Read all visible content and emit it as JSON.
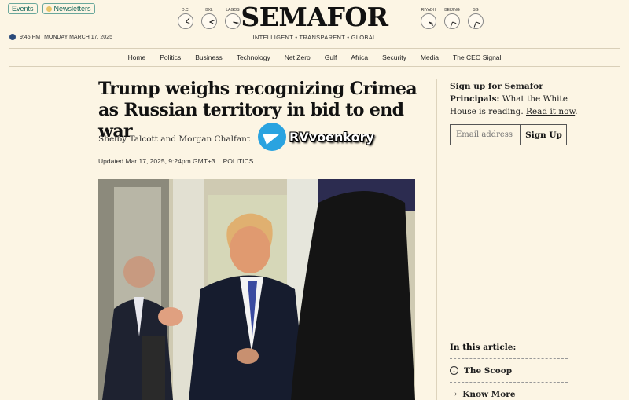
{
  "header": {
    "pills": [
      {
        "label": "Events",
        "icon": "events"
      },
      {
        "label": "Newsletters",
        "icon": "newsletter-dot-icon"
      }
    ],
    "logo": "SEMAFOR",
    "tagline": "INTELLIGENT  •  TRANSPARENT  •  GLOBAL",
    "time": "9:45 PM",
    "date": "MONDAY MARCH 17, 2025",
    "clocks_left": [
      "D.C.",
      "BXL",
      "LAGOS"
    ],
    "clocks_right": [
      "RIYADH",
      "BEIJING",
      "SG"
    ]
  },
  "nav": {
    "items": [
      "Home",
      "Politics",
      "Business",
      "Technology",
      "Net Zero",
      "Gulf",
      "Africa",
      "Security",
      "Media",
      "The CEO Signal"
    ]
  },
  "article": {
    "headline": "Trump weighs recognizing Crimea as Russian territory in bid to end war",
    "byline": "Shelby Talcott and Morgan Chalfant",
    "updated": "Updated Mar 17, 2025, 9:24pm GMT+3",
    "section": "POLITICS"
  },
  "watermark": {
    "text": "RVvoenkory"
  },
  "sidebar": {
    "signup_bold": "Sign up for Semafor Principals:",
    "signup_text": " What the White House is reading. ",
    "signup_link": "Read it now",
    "signup_end": ".",
    "email_placeholder": "Email address",
    "signup_button": "Sign Up",
    "in_article_title": "In this article:",
    "in_article_items": [
      "The Scoop",
      "Know More"
    ]
  },
  "colors": {
    "background": "#fcf5e4",
    "pill_accent": "#1a6a5e",
    "telegram": "#2aa3e0"
  }
}
